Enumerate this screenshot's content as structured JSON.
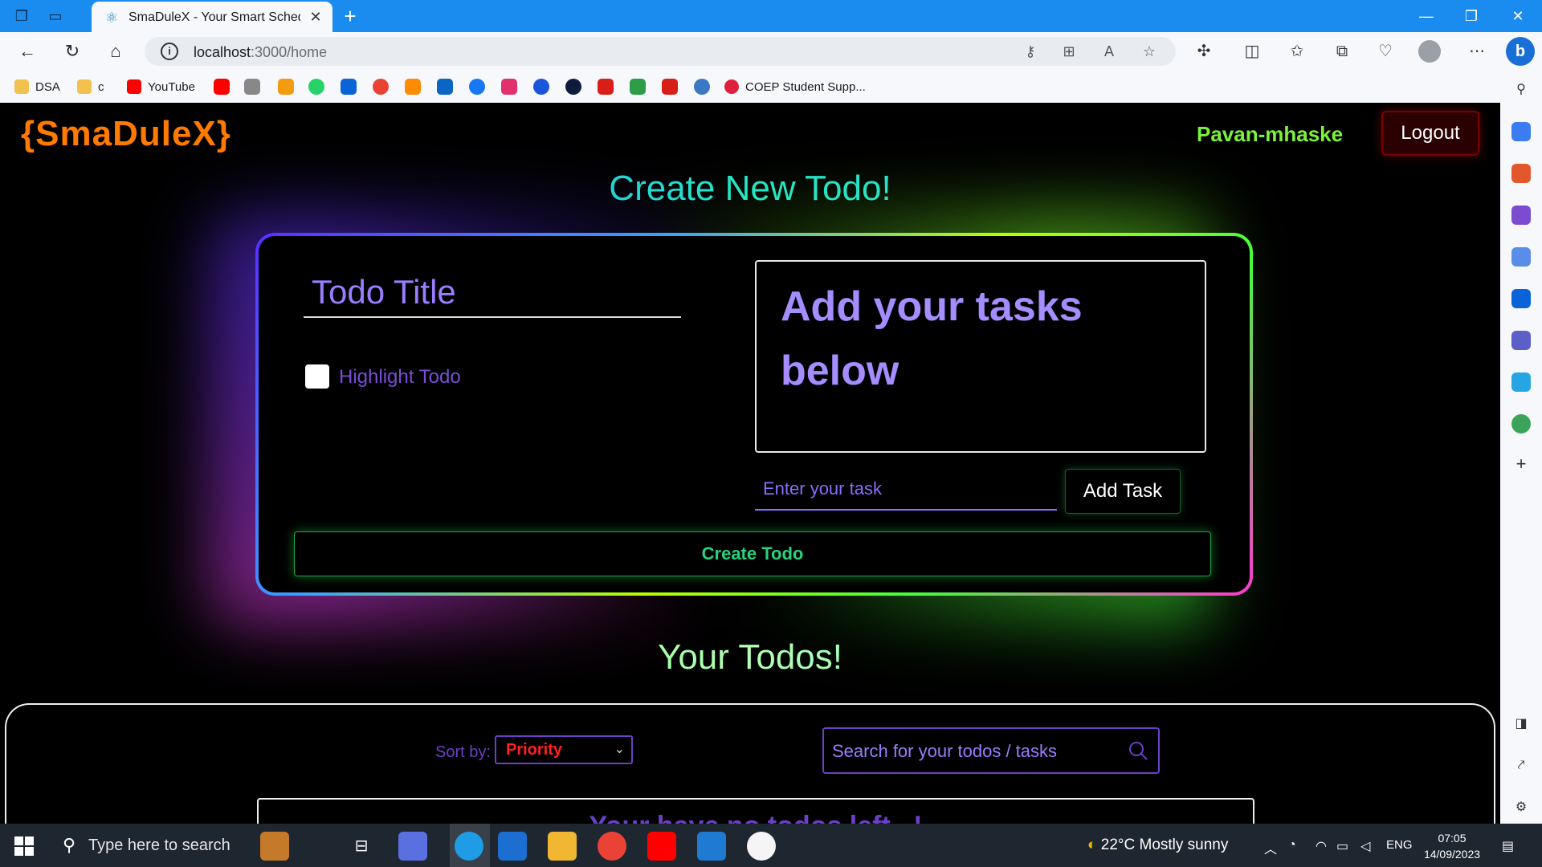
{
  "browser": {
    "tab_title": "SmaDuleX - Your Smart Scheduling",
    "address_host": "localhost",
    "address_path": ":3000/home",
    "bookmarks": [
      {
        "label": "DSA",
        "color": "#f2c14e"
      },
      {
        "label": "c",
        "color": "#f2c14e"
      },
      {
        "label": "YouTube",
        "color": "#ff0000"
      },
      {
        "label": "COEP Student Supp...",
        "color": "#e0203a"
      }
    ]
  },
  "header": {
    "brand": "{SmaDuleX}",
    "username": "Pavan-mhaske",
    "logout_label": "Logout"
  },
  "create": {
    "heading": "Create New Todo!",
    "title_placeholder": "Todo Title",
    "highlight_label": "Highlight Todo",
    "tasks_heading": "Add your tasks below",
    "task_placeholder": "Enter your task",
    "add_task_label": "Add Task",
    "create_label": "Create Todo"
  },
  "todos": {
    "heading": "Your Todos!",
    "sort_label": "Sort by:",
    "sort_value": "Priority",
    "search_placeholder": "Search for your todos / tasks",
    "empty_message": "Your have no todos left...!"
  },
  "taskbar": {
    "search_placeholder": "Type here to search",
    "weather": "22°C  Mostly sunny",
    "language": "ENG",
    "time": "07:05",
    "date": "14/09/2023"
  },
  "colors": {
    "brand": "#ff7a00",
    "username": "#7cf23a",
    "accent_purple": "#6c3fc9",
    "create_button": "#29d17b"
  }
}
